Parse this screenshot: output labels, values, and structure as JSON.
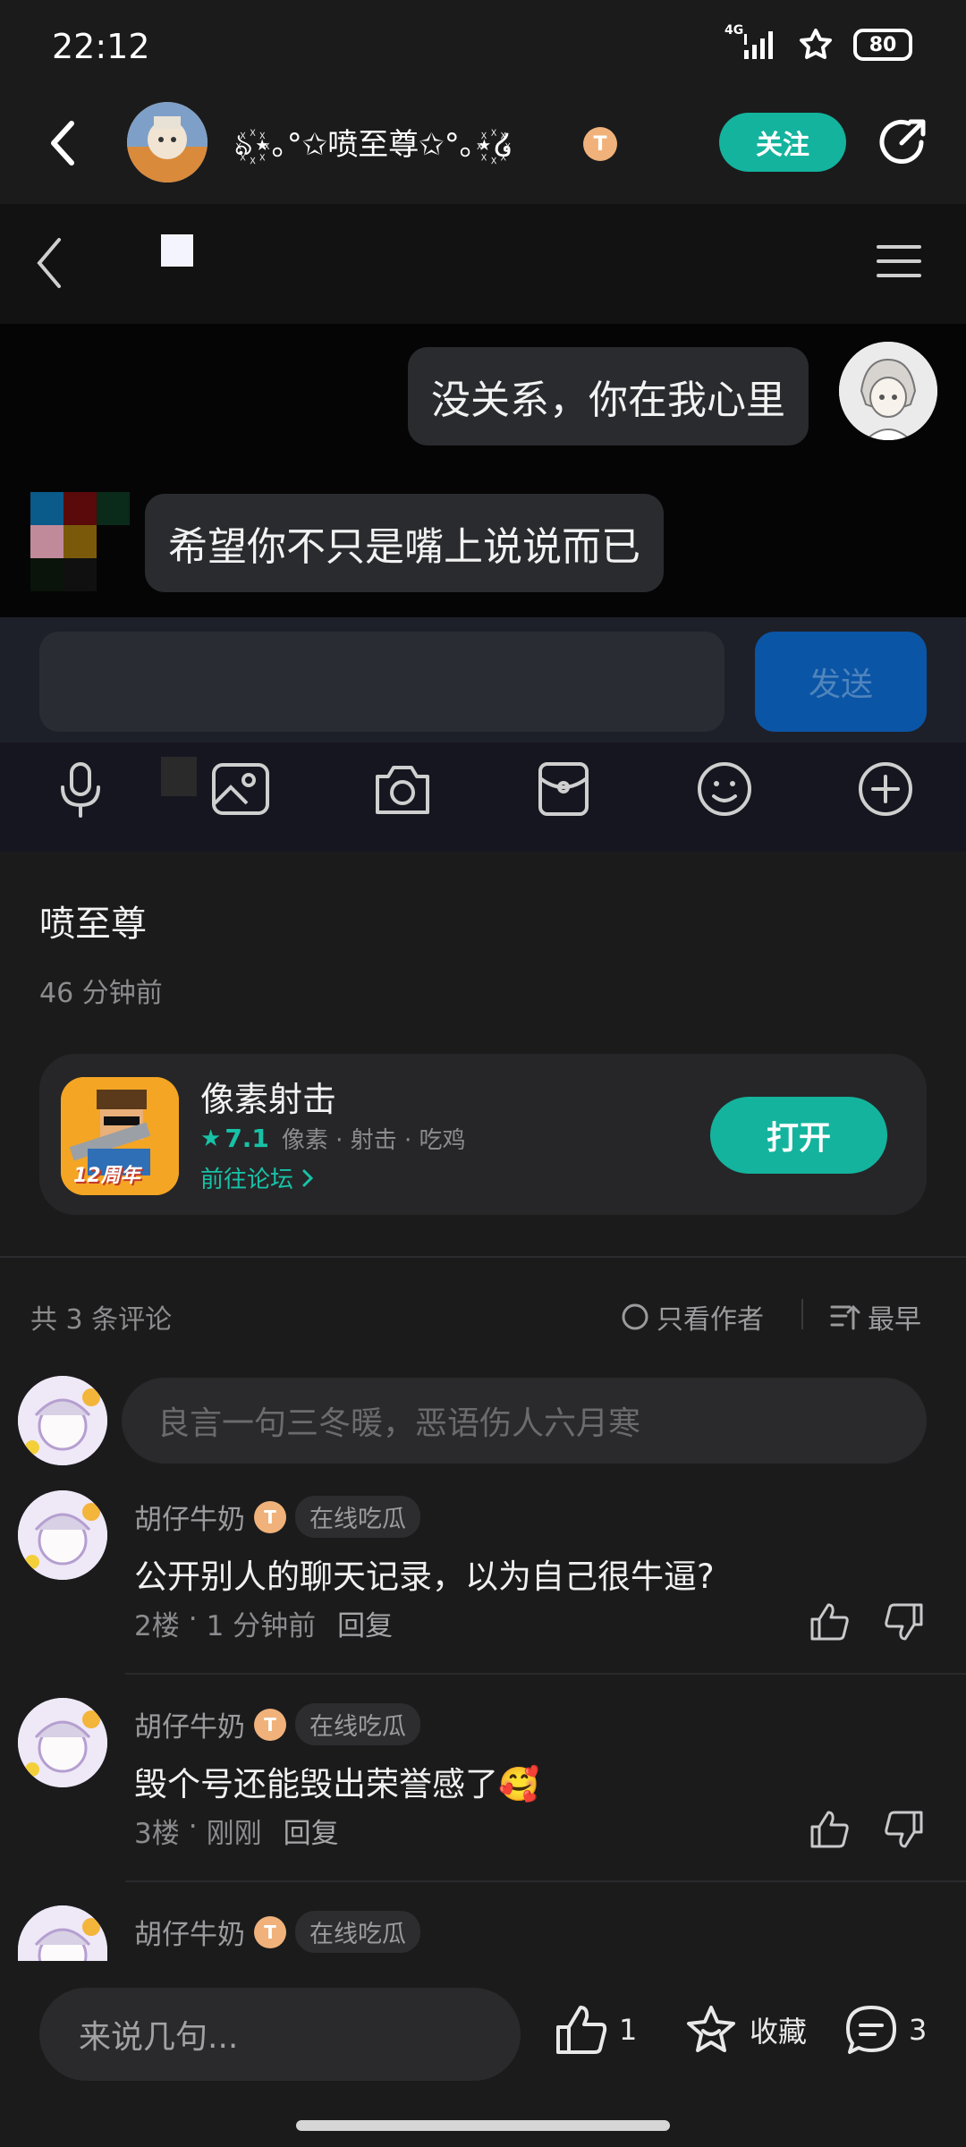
{
  "status": {
    "time": "22:12",
    "network": "4G",
    "battery": "80"
  },
  "header": {
    "title": "ঌ꙰⋆｡°✩喷至尊✩°｡⋆꙰໒",
    "badge": "T",
    "follow": "关注"
  },
  "screenshot": {
    "msg_out": "没关系，你在我心里",
    "msg_in": "希望你不只是嘴上说说而已",
    "send": "发送"
  },
  "post": {
    "author": "喷至尊",
    "time": "46 分钟前"
  },
  "app": {
    "name": "像素射击",
    "rating": "7.1",
    "tags": "像素 · 射击 · 吃鸡",
    "forum": "前往论坛",
    "open": "打开",
    "anniversary": "12周年"
  },
  "comments_header": {
    "count": "共 3 条评论",
    "only_author": "只看作者",
    "sort": "最早"
  },
  "comment_input_placeholder": "良言一句三冬暖，恶语伤人六月寒",
  "comments": [
    {
      "name": "胡仔牛奶",
      "badge": "T",
      "tag": "在线吃瓜",
      "text": "公开别人的聊天记录，以为自己很牛逼?",
      "floor": "2楼",
      "time": "1 分钟前",
      "reply": "回复"
    },
    {
      "name": "胡仔牛奶",
      "badge": "T",
      "tag": "在线吃瓜",
      "text": "毁个号还能毁出荣誉感了🥰",
      "floor": "3楼",
      "time": "刚刚",
      "reply": "回复"
    },
    {
      "name": "胡仔牛奶",
      "badge": "T",
      "tag": "在线吃瓜"
    }
  ],
  "bottom": {
    "placeholder": "来说几句...",
    "likes": "1",
    "favorite": "收藏",
    "comments": "3"
  }
}
